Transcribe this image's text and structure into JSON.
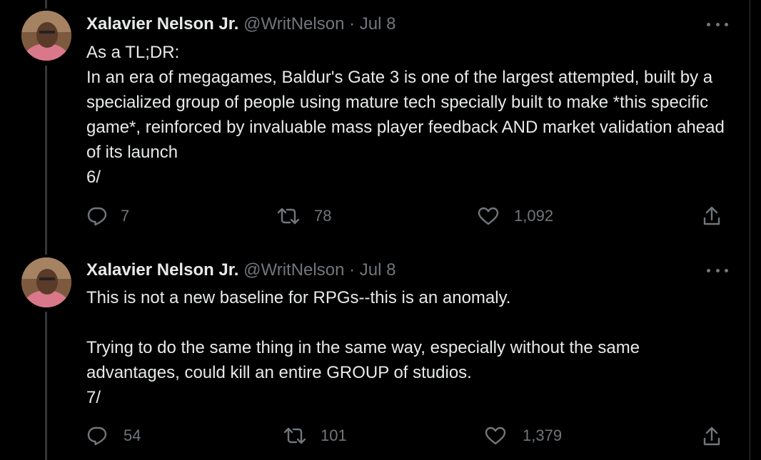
{
  "tweets": [
    {
      "name": "Xalavier Nelson Jr.",
      "handle": "@WritNelson",
      "separator": "·",
      "date": "Jul 8",
      "text": "As a TL;DR:\nIn an era of megagames, Baldur's Gate 3 is one of the largest attempted, built by a specialized group of people using mature tech specially built to make *this specific game*, reinforced by invaluable mass player feedback AND market validation ahead of its launch\n6/",
      "replies": "7",
      "reposts": "78",
      "likes": "1,092"
    },
    {
      "name": "Xalavier Nelson Jr.",
      "handle": "@WritNelson",
      "separator": "·",
      "date": "Jul 8",
      "text": "This is not a new baseline for RPGs--this is an anomaly.\n\nTrying to do the same thing in the same way, especially without the same advantages, could kill an entire GROUP of studios.\n7/",
      "replies": "54",
      "reposts": "101",
      "likes": "1,379"
    }
  ],
  "icons": {
    "reply": "speech-bubble",
    "repost": "two-arrows-loop",
    "like": "heart-outline",
    "share": "arrow-up-from-tray",
    "more": "horizontal-ellipsis"
  },
  "colors": {
    "background": "#000000",
    "text_primary": "#e7e9ea",
    "text_secondary": "#71767b",
    "thread_line": "#333639"
  }
}
